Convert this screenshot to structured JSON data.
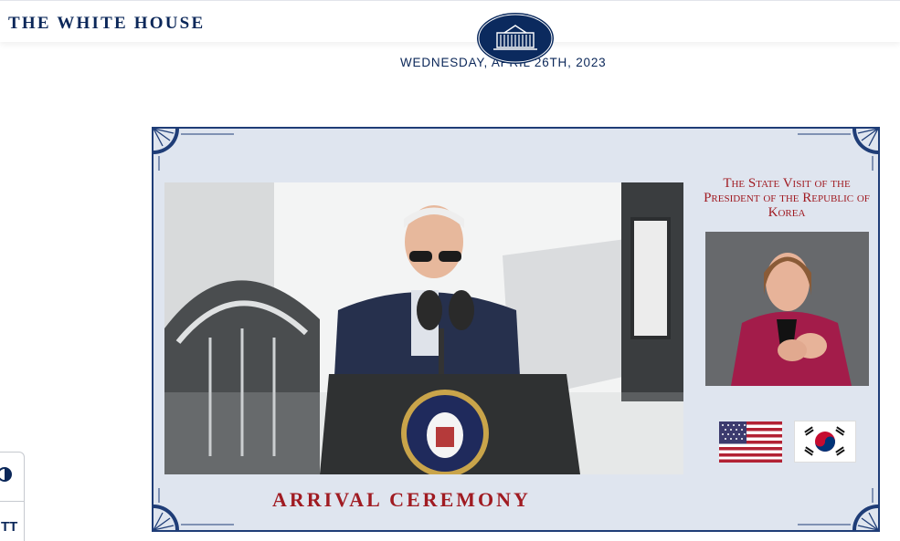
{
  "header": {
    "brand": "THE WHITE HOUSE",
    "logo_icon": "white-house-seal-icon"
  },
  "date": "WEDNESDAY, APRIL 26TH, 2023",
  "panel": {
    "visit_title": "The State Visit of the President of the Republic of Korea",
    "caption": "ARRIVAL CEREMONY"
  },
  "colors": {
    "navy": "#0b2759",
    "panel_bg": "#dfe5ef",
    "caption_red": "#a01b22"
  },
  "a11y": {
    "contrast_icon": "contrast-icon",
    "text_size_icon": "text-size-icon",
    "text_size_glyph": "TT"
  }
}
